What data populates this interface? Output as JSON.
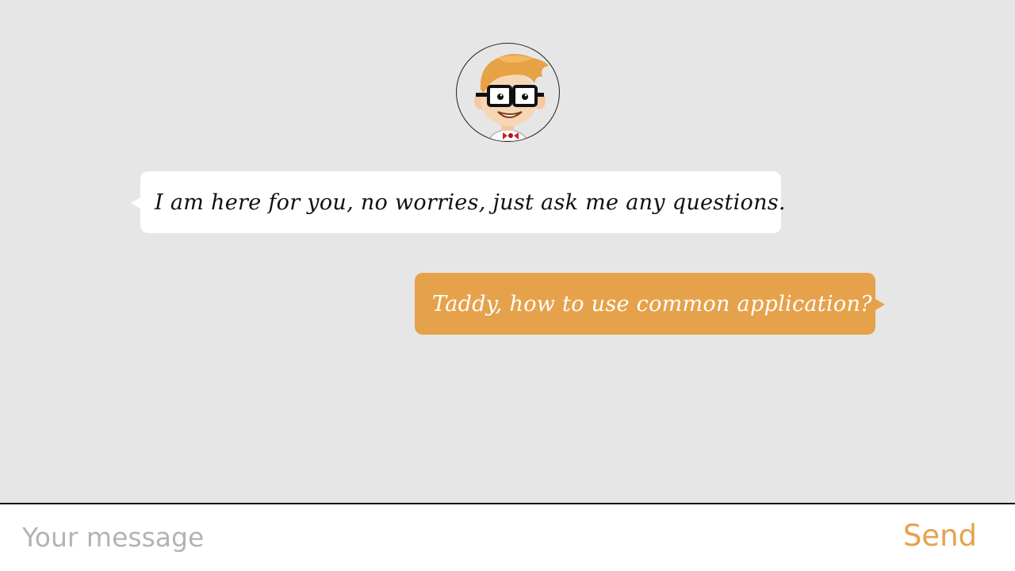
{
  "conversation": {
    "assistant_avatar": "nerdy-boy-avatar",
    "messages": [
      {
        "sender": "assistant",
        "text": "I am here for you, no worries, just ask me any questions."
      },
      {
        "sender": "user",
        "text": "Taddy, how to use common application?"
      }
    ]
  },
  "composer": {
    "placeholder": "Your message",
    "value": "",
    "send_label": "Send"
  },
  "colors": {
    "background": "#e6e6e6",
    "accent": "#e6a24b",
    "assistant_bubble": "#ffffff",
    "placeholder": "#b3b3b3"
  }
}
